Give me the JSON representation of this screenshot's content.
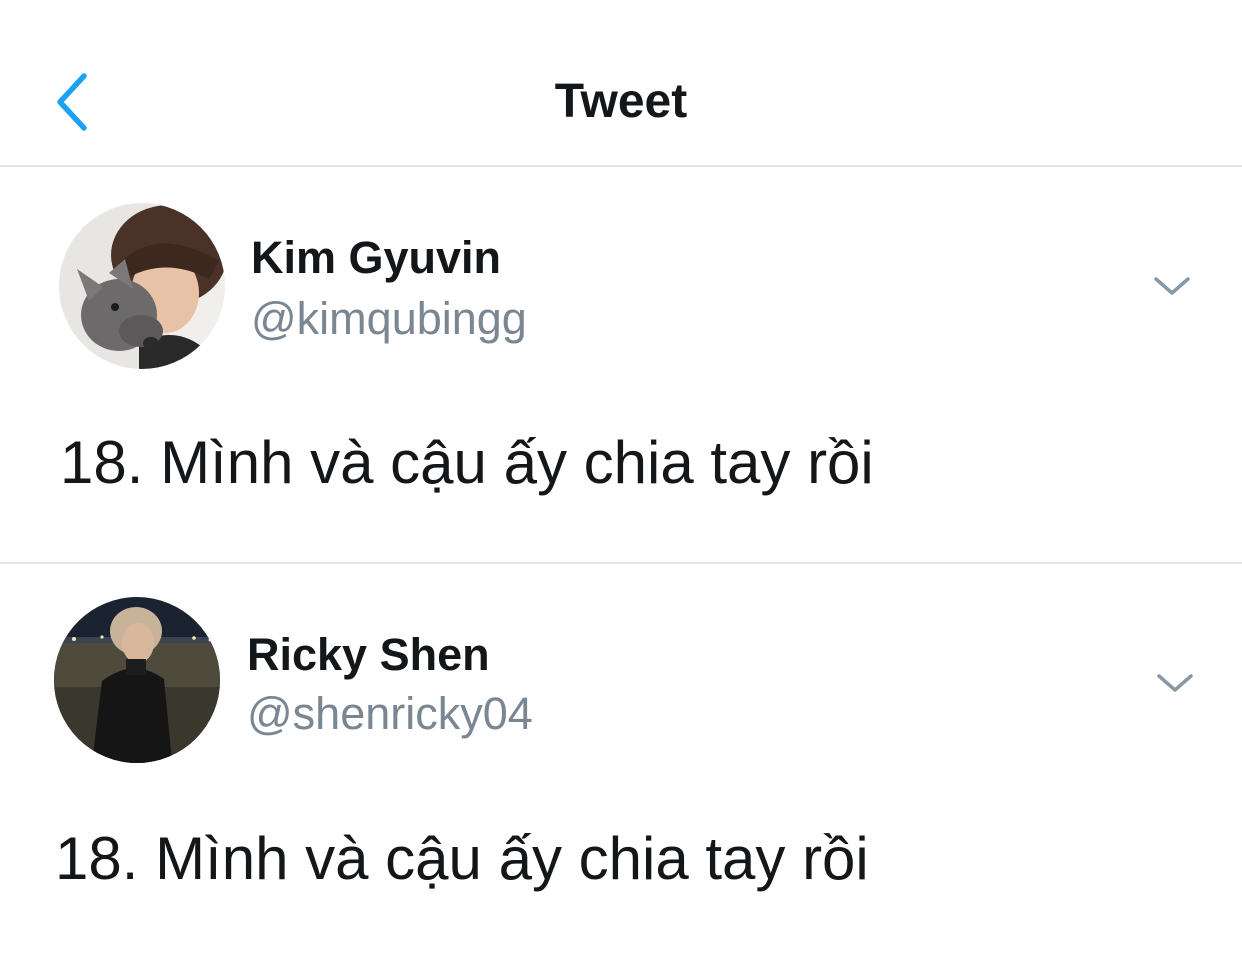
{
  "nav": {
    "title": "Tweet",
    "back_icon": "chevron-left-icon",
    "accent_color": "#1da1f2"
  },
  "tweets": [
    {
      "display_name": "Kim Gyuvin",
      "handle": "@kimqubingg",
      "text": "18. Mình và cậu ấy chia tay rồi",
      "avatar": "avatar-photo-with-dog",
      "menu_icon": "chevron-down-icon"
    },
    {
      "display_name": "Ricky Shen",
      "handle": "@shenricky04",
      "text": "18. Mình và cậu ấy chia tay rồi",
      "avatar": "avatar-photo-night-outdoor",
      "menu_icon": "chevron-down-icon"
    }
  ],
  "colors": {
    "text_primary": "#14171a",
    "text_secondary": "#7a8793",
    "divider": "#e1e4e8"
  }
}
